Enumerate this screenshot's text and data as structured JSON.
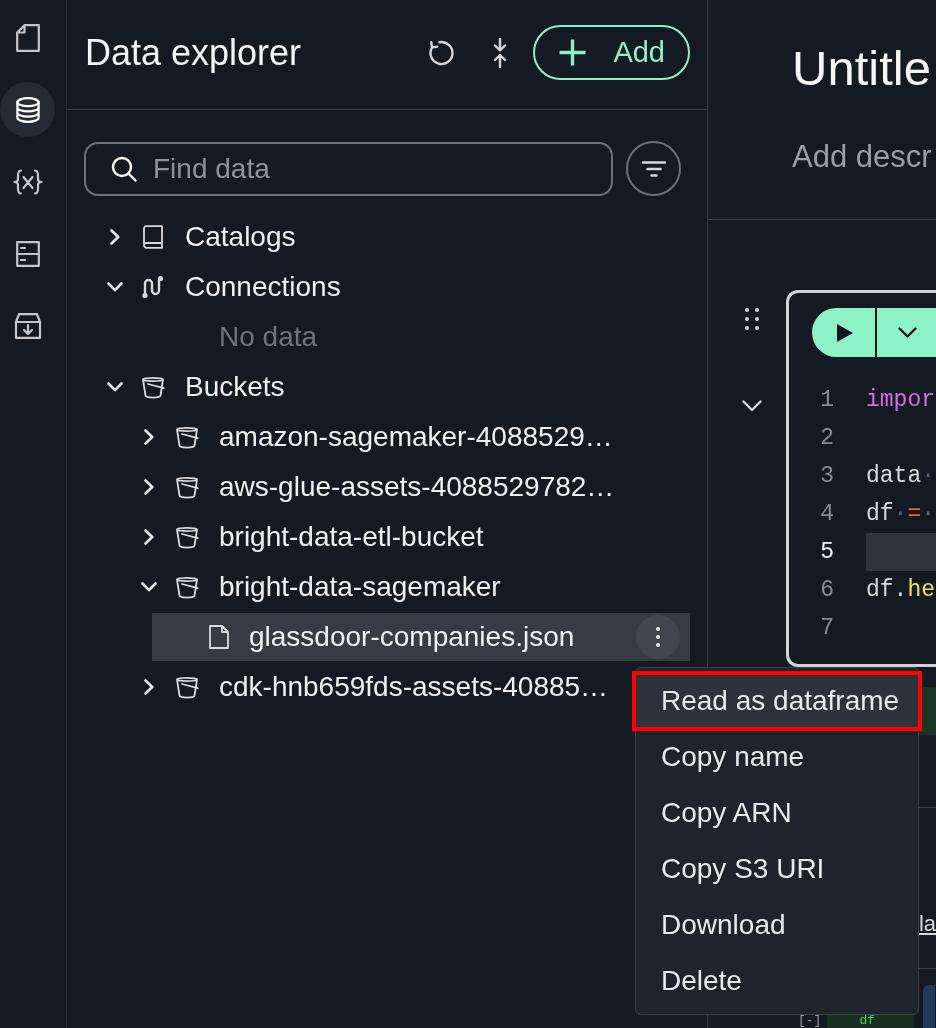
{
  "rail": [
    {
      "kind": "notebook",
      "selected": false
    },
    {
      "kind": "data",
      "selected": true
    },
    {
      "kind": "variables",
      "selected": false
    },
    {
      "kind": "compute",
      "selected": false
    },
    {
      "kind": "packages",
      "selected": false
    }
  ],
  "explorer": {
    "title": "Data explorer",
    "add_button": {
      "label": "Add"
    },
    "search": {
      "placeholder": "Find data"
    },
    "tree": [
      {
        "label": "Catalogs",
        "kind": "catalogs",
        "expanded": false,
        "selected": false
      },
      {
        "label": "Connections",
        "kind": "connections",
        "expanded": true,
        "selected": false,
        "children": [
          {
            "label": "No data",
            "kind": "empty"
          }
        ]
      },
      {
        "label": "Buckets",
        "kind": "bucket",
        "expanded": true,
        "selected": false,
        "children": [
          {
            "label": "amazon-sagemaker-4088529…",
            "kind": "bucket",
            "expanded": false,
            "selected": false
          },
          {
            "label": "aws-glue-assets-4088529782…",
            "kind": "bucket",
            "expanded": false,
            "selected": false
          },
          {
            "label": "bright-data-etl-bucket",
            "kind": "bucket",
            "expanded": false,
            "selected": false
          },
          {
            "label": "bright-data-sagemaker",
            "kind": "bucket",
            "expanded": true,
            "selected": false,
            "children": [
              {
                "label": "glassdoor-companies.json",
                "kind": "file",
                "selected": true
              }
            ]
          },
          {
            "label": "cdk-hnb659fds-assets-40885…",
            "kind": "bucket",
            "expanded": false,
            "selected": false
          }
        ]
      }
    ]
  },
  "context_menu": {
    "items": [
      {
        "label": "Read as dataframe",
        "selected": true,
        "outlined": true
      },
      {
        "label": "Copy name",
        "selected": false,
        "outlined": false
      },
      {
        "label": "Copy ARN",
        "selected": false,
        "outlined": false
      },
      {
        "label": "Copy S3 URI",
        "selected": false,
        "outlined": false
      },
      {
        "label": "Download",
        "selected": false,
        "outlined": false
      },
      {
        "label": "Delete",
        "selected": false,
        "outlined": false
      }
    ]
  },
  "notebook": {
    "title": "Untitle",
    "description": {
      "placeholder": "Add descr"
    },
    "cell": {
      "lines": [
        {
          "number": "1",
          "current": false,
          "tokens": [
            {
              "text": "impor",
              "kind": "keyword"
            }
          ]
        },
        {
          "number": "2",
          "current": false
        },
        {
          "number": "3",
          "current": false,
          "tokens": [
            {
              "text": "data",
              "kind": "name"
            },
            {
              "text": "·",
              "kind": "space"
            }
          ]
        },
        {
          "number": "4",
          "current": false,
          "tokens": [
            {
              "text": "df",
              "kind": "name"
            },
            {
              "text": "·",
              "kind": "space"
            },
            {
              "text": "=",
              "kind": "operator"
            },
            {
              "text": "·",
              "kind": "space"
            }
          ]
        },
        {
          "number": "5",
          "current": true
        },
        {
          "number": "6",
          "current": false,
          "tokens": [
            {
              "text": "df.",
              "kind": "name"
            },
            {
              "text": "he",
              "kind": "method"
            }
          ]
        },
        {
          "number": "7",
          "current": false
        }
      ]
    },
    "output": {
      "link": "la"
    },
    "next_cell": {
      "counter": "[-]",
      "code": "df"
    }
  }
}
